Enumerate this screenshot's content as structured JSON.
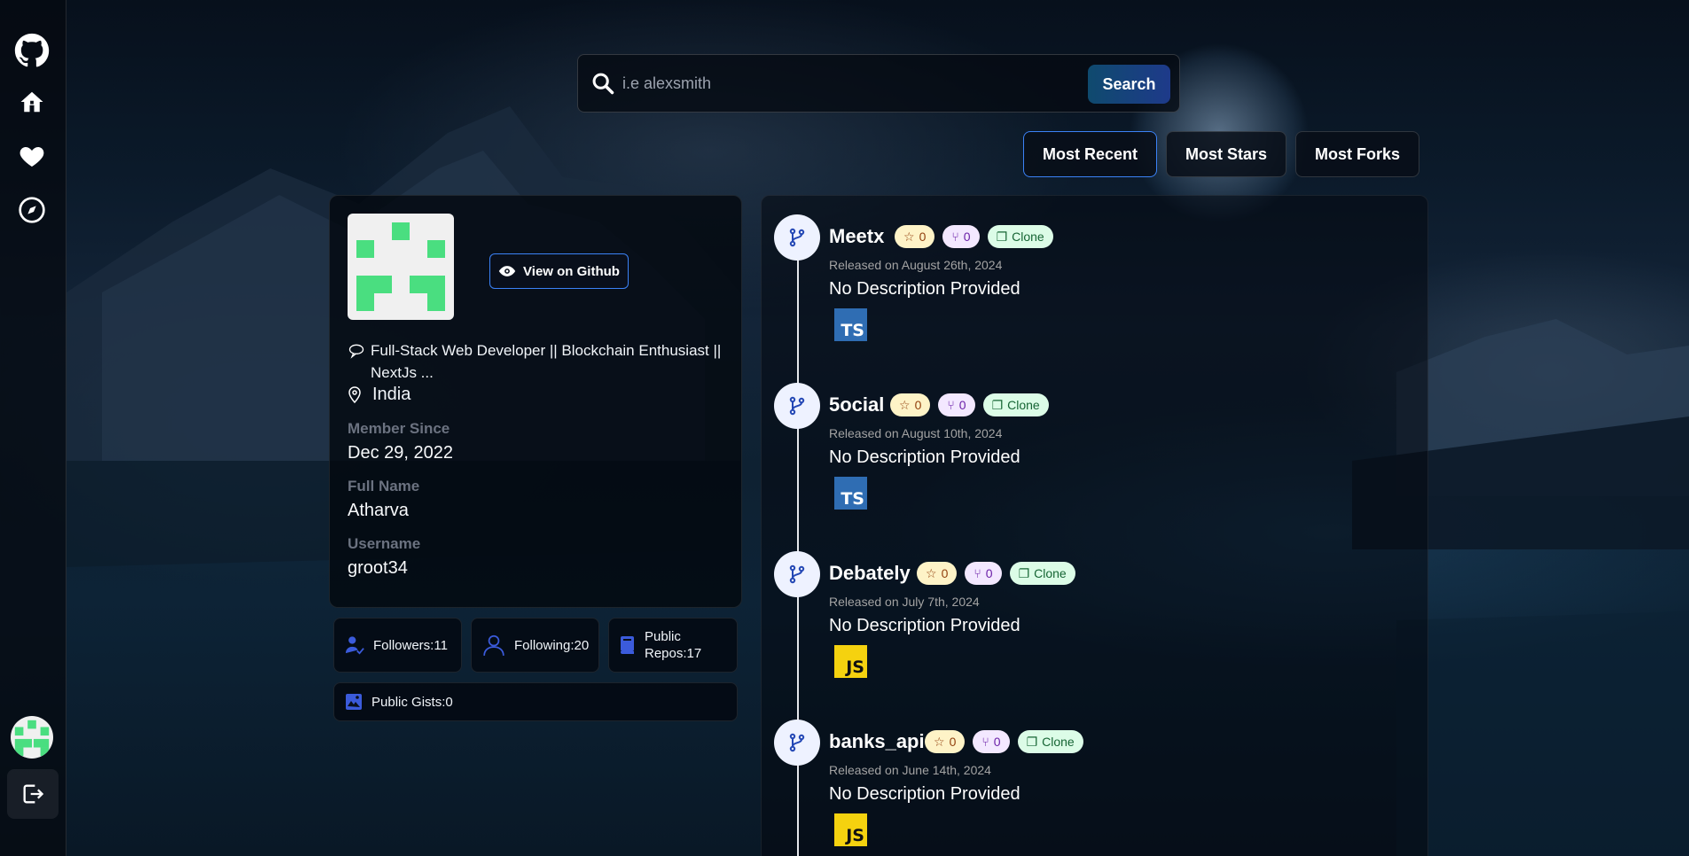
{
  "sidebar": {
    "items": [
      {
        "name": "github-logo-icon"
      },
      {
        "name": "home-icon"
      },
      {
        "name": "heart-icon"
      },
      {
        "name": "explore-icon"
      }
    ],
    "logout_icon": "logout-icon"
  },
  "search": {
    "placeholder": "i.e alexsmith",
    "button_label": "Search"
  },
  "sort": {
    "most_recent": "Most Recent",
    "most_stars": "Most Stars",
    "most_forks": "Most Forks",
    "active": "Most Recent"
  },
  "profile": {
    "view_github_label": "View on Github",
    "bio": "Full-Stack Web Developer || Blockchain Enthusiast || NextJs ...",
    "location": "India",
    "member_since_label": "Member Since",
    "member_since": "Dec 29, 2022",
    "full_name_label": "Full Name",
    "full_name": "Atharva",
    "username_label": "Username",
    "username": "groot34"
  },
  "stats": {
    "followers": "Followers:11",
    "following": "Following:20",
    "public_repos": "Public Repos:17",
    "public_gists": "Public Gists:0"
  },
  "repos": [
    {
      "name": "Meetx",
      "stars": "0",
      "forks": "0",
      "clone_label": "Clone",
      "released": "Released on August 26th, 2024",
      "description": "No Description Provided",
      "lang": "TS"
    },
    {
      "name": "5ocial",
      "stars": "0",
      "forks": "0",
      "clone_label": "Clone",
      "released": "Released on August 10th, 2024",
      "description": "No Description Provided",
      "lang": "TS"
    },
    {
      "name": "Debately",
      "stars": "0",
      "forks": "0",
      "clone_label": "Clone",
      "released": "Released on July 7th, 2024",
      "description": "No Description Provided",
      "lang": "JS"
    },
    {
      "name": "banks_api",
      "stars": "0",
      "forks": "0",
      "clone_label": "Clone",
      "released": "Released on June 14th, 2024",
      "description": "No Description Provided",
      "lang": "JS"
    }
  ],
  "colors": {
    "accent": "#3b82f6",
    "avatar_green": "#4ade80",
    "ts": "#2f6db3",
    "js": "#f5d20f"
  }
}
